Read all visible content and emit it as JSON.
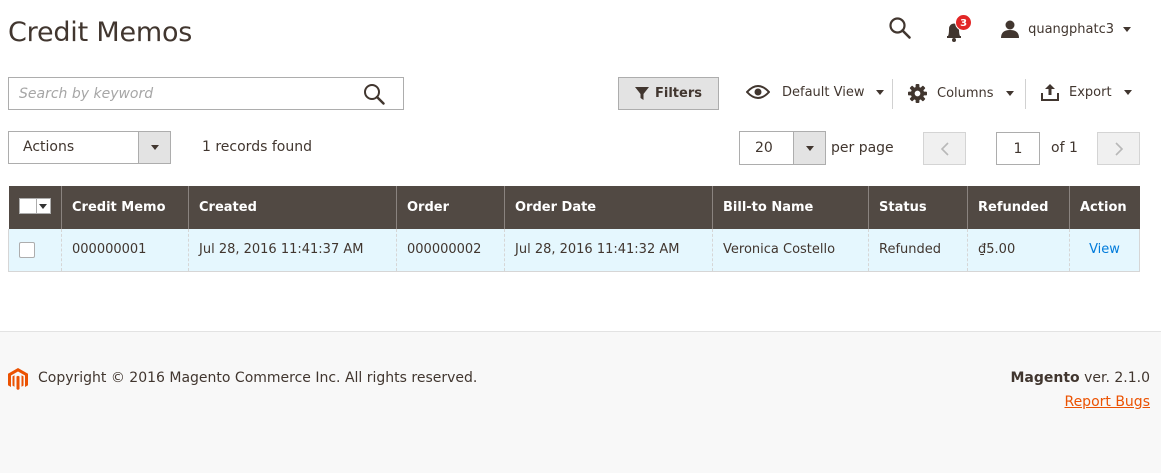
{
  "page": {
    "title": "Credit Memos"
  },
  "header": {
    "notification_count": "3",
    "username": "quangphatc3"
  },
  "search": {
    "placeholder": "Search by keyword"
  },
  "toolbar": {
    "filters_label": "Filters",
    "view_label": "Default View",
    "columns_label": "Columns",
    "export_label": "Export"
  },
  "grid_controls": {
    "actions_label": "Actions",
    "records_found": "1 records found",
    "per_page_value": "20",
    "per_page_label": "per page",
    "current_page": "1",
    "page_total": "of 1"
  },
  "table": {
    "columns": [
      "Credit Memo",
      "Created",
      "Order",
      "Order Date",
      "Bill-to Name",
      "Status",
      "Refunded",
      "Action"
    ],
    "rows": [
      {
        "credit_memo": "000000001",
        "created": "Jul 28, 2016 11:41:37 AM",
        "order": "000000002",
        "order_date": "Jul 28, 2016 11:41:32 AM",
        "bill_to": "Veronica Costello",
        "status": "Refunded",
        "refunded": "₫5.00",
        "action": "View"
      }
    ]
  },
  "footer": {
    "copyright": "Copyright © 2016 Magento Commerce Inc. All rights reserved.",
    "brand": "Magento",
    "version": " ver. 2.1.0",
    "report_bugs": "Report Bugs"
  },
  "colors": {
    "header_bg": "#514943",
    "row_bg": "#e5f7fe",
    "accent": "#eb5202",
    "link": "#007bdb",
    "badge": "#e22626"
  },
  "icons": [
    "search-icon",
    "bell-icon",
    "user-icon",
    "filter-icon",
    "eye-icon",
    "gear-icon",
    "export-icon",
    "chevron-left-icon",
    "chevron-right-icon",
    "magento-logo-icon"
  ]
}
